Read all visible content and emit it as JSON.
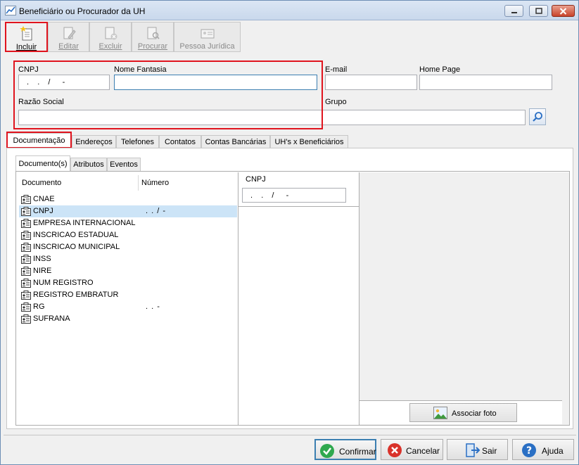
{
  "window": {
    "title": "Beneficiário ou Procurador da UH"
  },
  "toolbar": {
    "incluir": "Incluir",
    "editar": "Editar",
    "excluir": "Excluir",
    "procurar": "Procurar",
    "pessoa_juridica": "Pessoa Jurídica"
  },
  "form": {
    "cnpj_label": "CNPJ",
    "cnpj_value": " .  .  /   -",
    "nome_fantasia_label": "Nome Fantasia",
    "nome_fantasia_value": "",
    "email_label": "E-mail",
    "email_value": "",
    "home_page_label": "Home Page",
    "home_page_value": "",
    "razao_social_label": "Razão Social",
    "razao_social_value": "",
    "grupo_label": "Grupo",
    "grupo_value": ""
  },
  "tabs": [
    "Documentação",
    "Endereços",
    "Telefones",
    "Contatos",
    "Contas Bancárias",
    "UH's x Beneficiários"
  ],
  "subtabs": [
    "Documento(s)",
    "Atributos",
    "Eventos"
  ],
  "documents": {
    "col_documento": "Documento",
    "col_numero": "Número",
    "rows": [
      {
        "name": "CNAE",
        "number": ""
      },
      {
        "name": "CNPJ",
        "number": ". .  /   -"
      },
      {
        "name": "EMPRESA INTERNACIONAL",
        "number": ""
      },
      {
        "name": "INSCRICAO ESTADUAL",
        "number": ""
      },
      {
        "name": "INSCRICAO MUNICIPAL",
        "number": ""
      },
      {
        "name": "INSS",
        "number": ""
      },
      {
        "name": "NIRE",
        "number": ""
      },
      {
        "name": "NUM REGISTRO",
        "number": ""
      },
      {
        "name": "REGISTRO EMBRATUR",
        "number": ""
      },
      {
        "name": "RG",
        "number": ". .  -"
      },
      {
        "name": "SUFRANA",
        "number": ""
      }
    ],
    "selected_index": 1
  },
  "detail": {
    "label": "CNPJ",
    "value": " .  .  /   -"
  },
  "photo": {
    "associar_foto": "Associar foto"
  },
  "buttons": {
    "confirmar": "Confirmar",
    "cancelar": "Cancelar",
    "sair": "Sair",
    "ajuda": "Ajuda"
  },
  "colors": {
    "highlight_red": "#e0141e",
    "selection_blue": "#cce4f7",
    "focus_blue": "#3c7fb1"
  }
}
